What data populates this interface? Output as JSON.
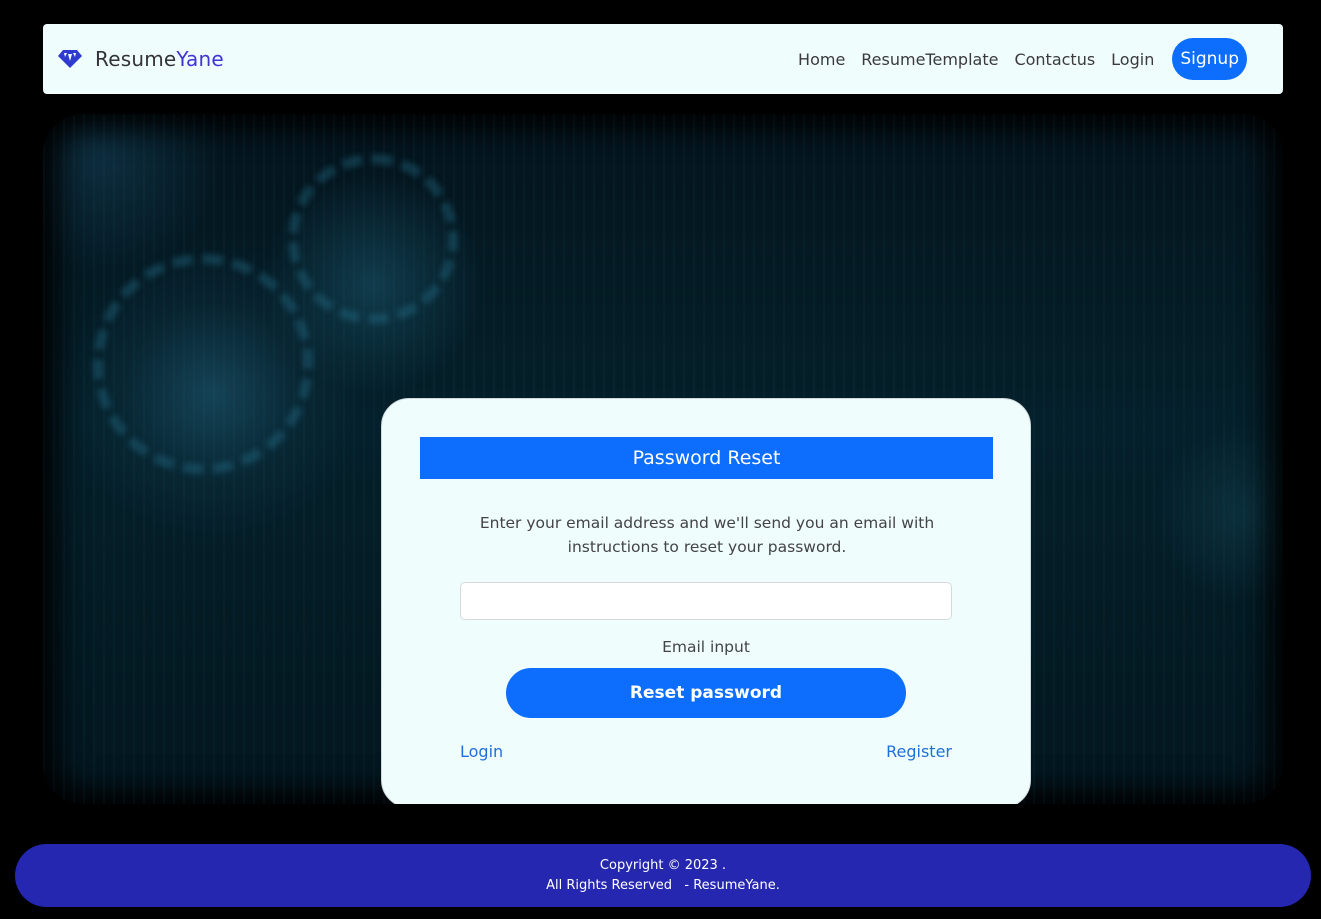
{
  "brand": {
    "name_main": "Resume",
    "name_accent": "Yane",
    "logo_icon": "diamond-icon",
    "accent_color": "#3d35d6"
  },
  "nav": {
    "items": [
      {
        "label": "Home"
      },
      {
        "label": "ResumeTemplate"
      },
      {
        "label": "Contactus"
      },
      {
        "label": "Login"
      }
    ],
    "signup_label": "Signup"
  },
  "card": {
    "title": "Password Reset",
    "description": "Enter your email address and we'll send you an email with instructions to reset your password.",
    "email_value": "",
    "email_label": "Email input",
    "reset_button": "Reset password",
    "login_link": "Login",
    "register_link": "Register"
  },
  "footer": {
    "copyright": "Copyright © 2023 .",
    "rights": "All Rights Reserved   - ResumeYane."
  },
  "colors": {
    "primary": "#0d6efd",
    "footer_bg": "#2527b0",
    "card_bg": "#effdfd",
    "page_bg": "#000000"
  }
}
